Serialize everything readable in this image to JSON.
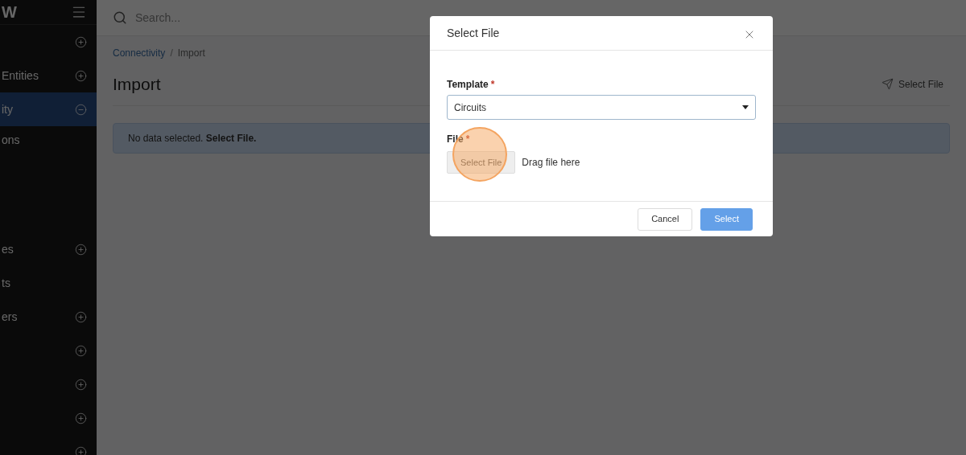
{
  "sidebar": {
    "logo": "W",
    "items": [
      {
        "expanded": false
      },
      {
        "label": "Entities",
        "expanded": false
      },
      {
        "label": "ity",
        "expanded": true,
        "selected": true,
        "children": [
          {
            "label": "ons"
          }
        ]
      },
      {
        "label": "es",
        "expanded": false
      },
      {
        "label": "ts"
      },
      {
        "label": "ers",
        "expanded": false
      },
      {
        "expanded": false
      },
      {
        "expanded": false
      },
      {
        "expanded": false
      },
      {
        "expanded": false
      }
    ]
  },
  "search": {
    "placeholder": "Search..."
  },
  "breadcrumb": {
    "separator": "/",
    "items": [
      {
        "label": "Connectivity",
        "link": true
      },
      {
        "label": "Import",
        "link": false
      }
    ]
  },
  "page_title": "Import",
  "header_action": "Select File",
  "alert": "No data selected. **Select File.**",
  "dialog": {
    "title": "Select File",
    "template": {
      "label": "Template",
      "required_mark": "*",
      "value": "Circuits"
    },
    "file": {
      "label": "File",
      "required_mark": "*",
      "button": "Select File",
      "hint": "Drag file here"
    },
    "buttons": [
      {
        "label": "Cancel",
        "kind": "secondary"
      },
      {
        "label": "Select",
        "kind": "primary"
      }
    ]
  }
}
